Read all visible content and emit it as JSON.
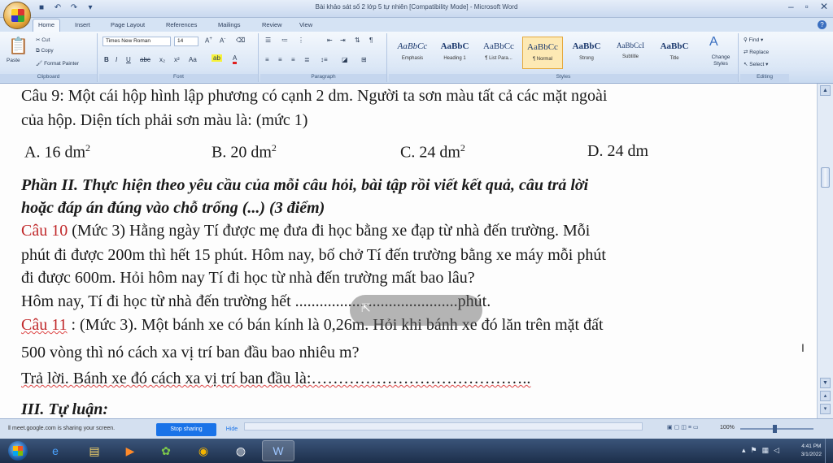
{
  "window": {
    "title": "Bài khảo sát số 2 lớp 5 tự nhiên [Compatibility Mode] - Microsoft Word",
    "controls": [
      "–",
      "▫",
      "✕"
    ]
  },
  "tabs": [
    "Home",
    "Insert",
    "Page Layout",
    "References",
    "Mailings",
    "Review",
    "View"
  ],
  "ribbon": {
    "clipboard": {
      "paste": "Paste",
      "cut": "Cut",
      "copy": "Copy",
      "format_painter": "Format Painter",
      "label": "Clipboard"
    },
    "font": {
      "name": "Times New Roman",
      "size": "14",
      "label": "Font"
    },
    "paragraph": {
      "label": "Paragraph"
    },
    "styles": {
      "label": "Styles",
      "items": [
        {
          "sample": "AaBbCc",
          "name": "Emphasis"
        },
        {
          "sample": "AaBbC",
          "name": "Heading 1"
        },
        {
          "sample": "AaBbCc",
          "name": "¶ List Para..."
        },
        {
          "sample": "AaBbCc",
          "name": "¶ Normal"
        },
        {
          "sample": "AaBbC",
          "name": "Strong"
        },
        {
          "sample": "AaBbCcI",
          "name": "Subtitle"
        },
        {
          "sample": "AaBbC",
          "name": "Title"
        }
      ],
      "change_styles": "Change Styles"
    },
    "editing": {
      "find": "Find",
      "replace": "Replace",
      "select": "Select",
      "label": "Editing"
    }
  },
  "document": {
    "q9_line1": "Câu 9: Một cái hộp  hình lập phương có cạnh 2 dm. Người ta sơn màu tất cả các mặt ngoài",
    "q9_line2": "của hộp. Diện tích phải sơn màu là:   (mức 1)",
    "q9_a": "A.  16 dm",
    "q9_b": "B. 20 dm",
    "q9_c": "C.  24 dm",
    "q9_d": "D. 24 dm",
    "sup2": "2",
    "part2_line1": "Phần II. Thực hiện theo yêu cầu của mỗi câu hỏi, bài tập rồi viết kết quả, câu trả lời",
    "part2_line2": "hoặc đáp án đúng vào chỗ trống (...) (3 điểm)",
    "q10_label": "Câu 10",
    "q10_line1": " (Mức 3) Hằng ngày Tí được mẹ đưa đi học bằng xe đạp từ nhà đến trường. Mỗi",
    "q10_line2": "phút đi được 200m thì hết 15 phút. Hôm nay, bố chở Tí đến trường bằng xe máy mỗi phút",
    "q10_line3": "đi được 600m. Hỏi hôm nay Tí đi học từ nhà đến trường mất bao lâu?",
    "q10_answer": "Hôm nay, Tí đi học từ nhà đến trường hết ........................................phút.",
    "q11_label": "Câu 11",
    "q11_line1": " : (Mức 3). Một bánh xe có bán kính là 0,26m. Hỏi khi bánh xe đó lăn trên mặt đất",
    "q11_line2": "500 vòng thì nó cách xa vị trí ban đầu bao nhiêu m?",
    "q11_answer": "Trả lời. Bánh xe đó cách xa vị trí ban đầu là:…………………………………..",
    "part3_partial": "III. Tự luận:"
  },
  "statusbar": {
    "share_message": "meet.google.com is sharing your screen.",
    "stop_sharing": "Stop sharing",
    "hide": "Hide",
    "zoom": "100%"
  },
  "taskbar": {
    "time": "4:41 PM",
    "date": "3/1/2022"
  }
}
